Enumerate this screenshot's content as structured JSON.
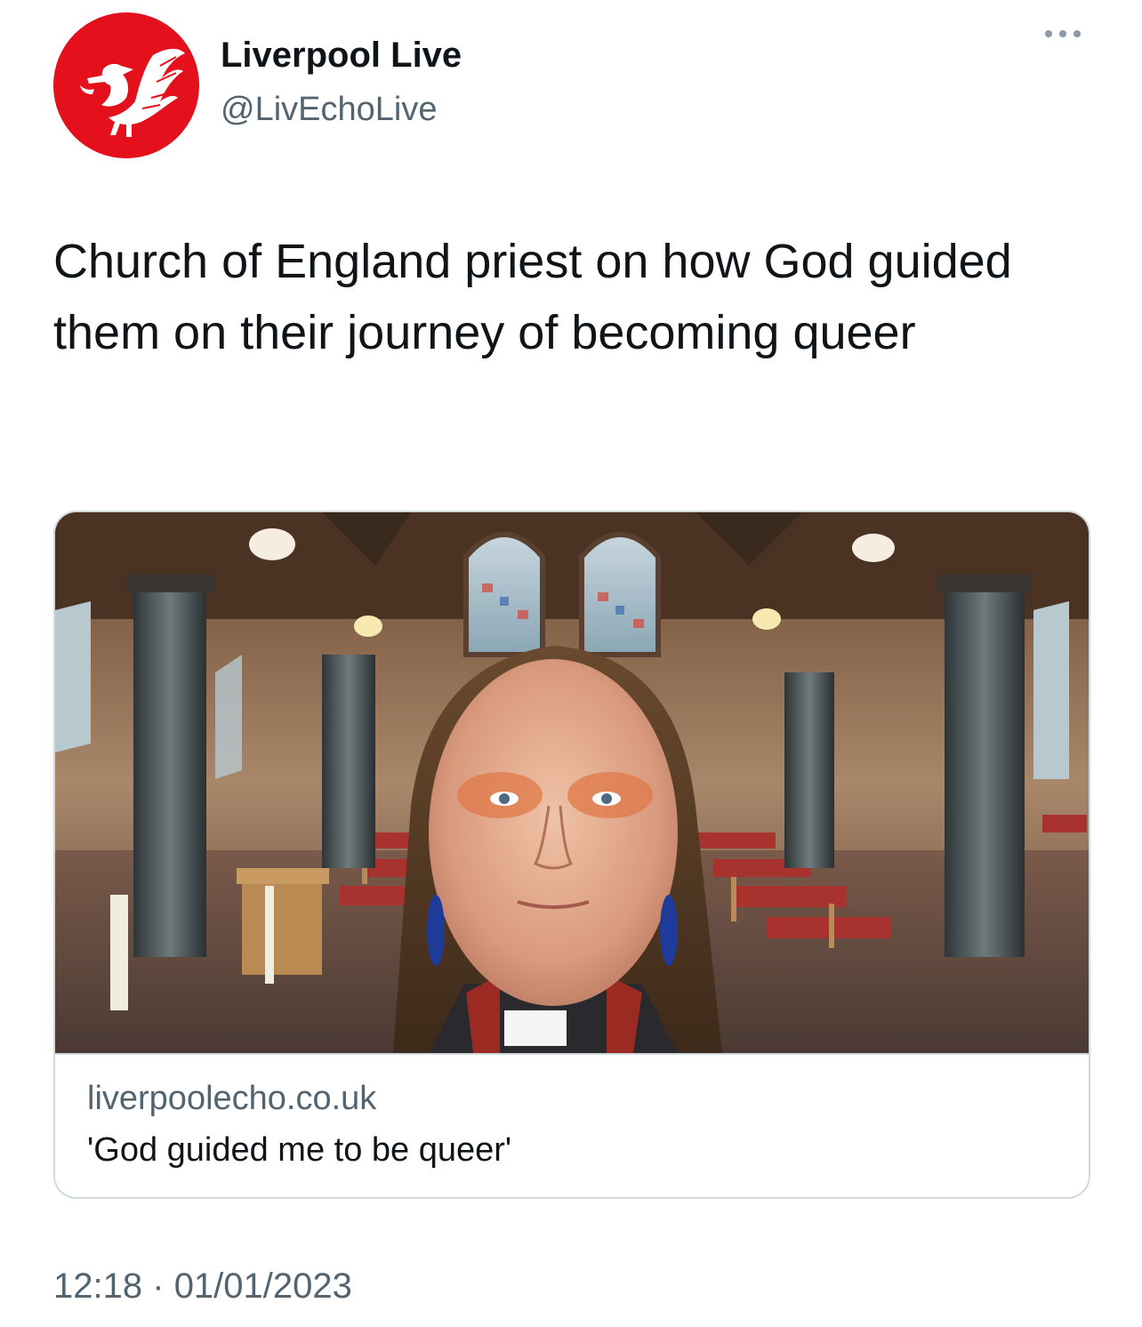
{
  "author": {
    "display_name": "Liverpool Live",
    "handle": "@LivEchoLive",
    "avatar_icon": "liver-bird-logo-icon",
    "avatar_color": "#e4101b"
  },
  "more_icon": "more-options-ellipsis-icon",
  "tweet": {
    "text": "Church of England priest on how God guided them on their journey of becoming queer"
  },
  "link_card": {
    "domain": "liverpoolecho.co.uk",
    "title": "'God guided me to be queer'",
    "image": "church-selfie-photo"
  },
  "meta": {
    "time": "12:18",
    "separator": "·",
    "date": "01/01/2023"
  },
  "colors": {
    "text_primary": "#0f1419",
    "text_secondary": "#536471",
    "border": "#cfd9de"
  }
}
